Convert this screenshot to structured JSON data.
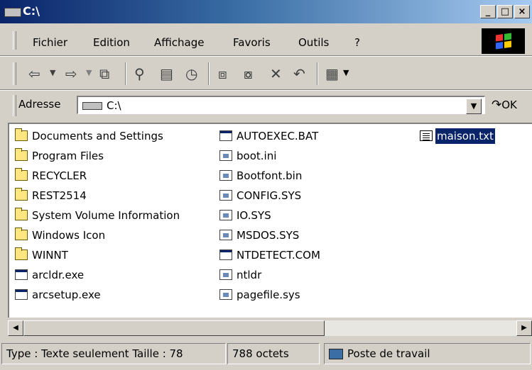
{
  "window": {
    "title": "C:\\"
  },
  "title_buttons": {
    "minimize": "_",
    "maximize": "□",
    "close": "×"
  },
  "menu": {
    "items": [
      "Fichier",
      "Edition",
      "Affichage",
      "Favoris",
      "Outils",
      "?"
    ]
  },
  "toolbar": {
    "buttons": [
      {
        "icon": "back-icon",
        "glyph": "⇦"
      },
      {
        "icon": "forward-icon",
        "glyph": "⇨"
      },
      {
        "icon": "up-folder-icon",
        "glyph": "⧉"
      },
      {
        "icon": "search-icon",
        "glyph": "⚲"
      },
      {
        "icon": "folders-icon",
        "glyph": "▤"
      },
      {
        "icon": "history-icon",
        "glyph": "◷"
      },
      {
        "icon": "move-to-icon",
        "glyph": "⧈"
      },
      {
        "icon": "copy-to-icon",
        "glyph": "⧇"
      },
      {
        "icon": "delete-icon",
        "glyph": "✕"
      },
      {
        "icon": "undo-icon",
        "glyph": "↶"
      },
      {
        "icon": "views-icon",
        "glyph": "▦"
      }
    ]
  },
  "address": {
    "label": "Adresse",
    "value": "C:\\",
    "go_label": "OK"
  },
  "files": {
    "col1": [
      {
        "name": "Documents and Settings",
        "type": "folder"
      },
      {
        "name": "Program Files",
        "type": "folder"
      },
      {
        "name": "RECYCLER",
        "type": "folder"
      },
      {
        "name": "REST2514",
        "type": "folder"
      },
      {
        "name": "System Volume Information",
        "type": "folder"
      },
      {
        "name": "Windows Icon",
        "type": "folder"
      },
      {
        "name": "WINNT",
        "type": "folder"
      },
      {
        "name": "arcldr.exe",
        "type": "exe"
      },
      {
        "name": "arcsetup.exe",
        "type": "exe"
      }
    ],
    "col2": [
      {
        "name": "AUTOEXEC.BAT",
        "type": "exe"
      },
      {
        "name": "boot.ini",
        "type": "file"
      },
      {
        "name": "Bootfont.bin",
        "type": "file"
      },
      {
        "name": "CONFIG.SYS",
        "type": "file"
      },
      {
        "name": "IO.SYS",
        "type": "file"
      },
      {
        "name": "MSDOS.SYS",
        "type": "file"
      },
      {
        "name": "NTDETECT.COM",
        "type": "exe"
      },
      {
        "name": "ntldr",
        "type": "file"
      },
      {
        "name": "pagefile.sys",
        "type": "file"
      }
    ],
    "col3": [
      {
        "name": "maison.txt",
        "type": "txt",
        "selected": true
      }
    ]
  },
  "scrollbar": {
    "left_arrow": "◀",
    "right_arrow": "▶"
  },
  "status": {
    "type_text": "Type : Texte seulement Taille : 78",
    "size_text": "788 octets",
    "location_text": "Poste de travail"
  }
}
